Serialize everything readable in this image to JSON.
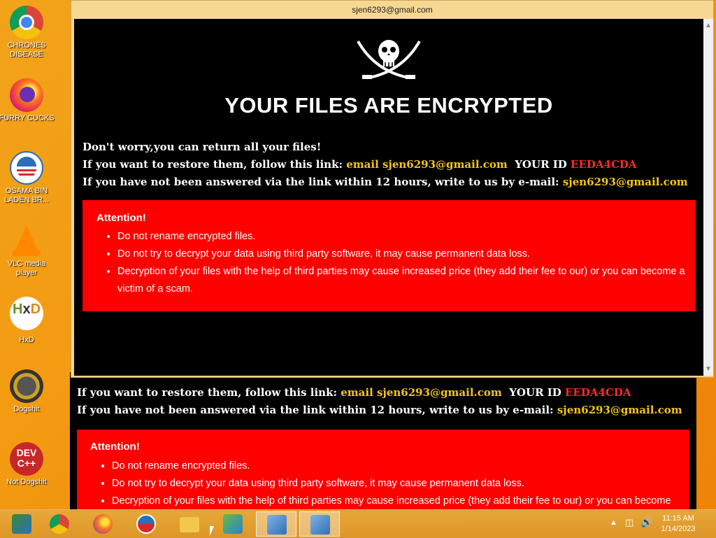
{
  "desktop": {
    "icons": [
      {
        "label": "CHRONES DISEASE",
        "icon": "chrome-icon"
      },
      {
        "label": "FURRY CUCKS",
        "icon": "firefox-icon"
      },
      {
        "label": "OSAMA BIN LADEN BR...",
        "icon": "obama-icon"
      },
      {
        "label": "VLC media player",
        "icon": "vlc-icon"
      },
      {
        "label": "HxD",
        "icon": "hxd-icon"
      },
      {
        "label": "Dogshit",
        "icon": "dogshit-icon"
      },
      {
        "label": "Not Dogshit",
        "icon": "devcpp-icon"
      }
    ],
    "devcpp_glyph": "DEV C++"
  },
  "window": {
    "title": "sjen6293@gmail.com",
    "headline": "YOUR FILES ARE ENCRYPTED",
    "line1": "Don't worry,you can return all your files!",
    "line2_prefix": "If you want to restore them, follow this link:",
    "line2_email": "email sjen6293@gmail.com",
    "line2_id_label": "YOUR ID",
    "line2_id": "EEDA4CDA",
    "line3_prefix": "If you have not been answered via the link within 12 hours, write to us by e-mail:",
    "line3_email": "sjen6293@gmail.com",
    "attention": {
      "title": "Attention!",
      "items": [
        "Do not rename encrypted files.",
        "Do not try to decrypt your data using third party software, it may cause permanent data loss.",
        "Decryption of your files with the help of third parties may cause increased price (they add their fee to our) or you can become a victim of a scam."
      ]
    }
  },
  "back_window": {
    "line2_prefix": "If you want to restore them, follow this link:",
    "line2_email": "email sjen6293@gmail.com",
    "line2_id_label": "YOUR ID",
    "line2_id": "EEDA4CDA",
    "line3_prefix": "If you have not been answered via the link within 12 hours, write to us by e-mail:",
    "line3_email": "sjen6293@gmail.com",
    "attention": {
      "title": "Attention!",
      "items": [
        "Do not rename encrypted files.",
        "Do not try to decrypt your data using third party software, it may cause permanent data loss.",
        "Decryption of your files with the help of third parties may cause increased price (they add their fee to our) or you can become"
      ]
    }
  },
  "taskbar": {
    "clock_time": "11:15 AM",
    "clock_date": "1/14/2023"
  },
  "colors": {
    "desktop": "#f39b12",
    "note_bg": "#000000",
    "attention_bg": "#ff0000",
    "email_highlight": "#f5c518",
    "id_highlight": "#ff2a2a"
  }
}
